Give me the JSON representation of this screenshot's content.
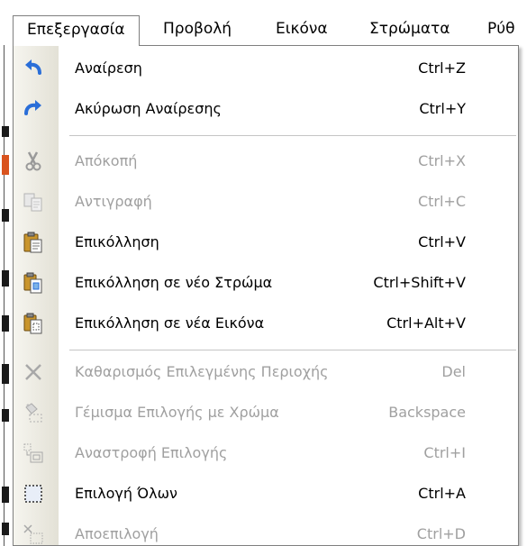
{
  "menubar": {
    "items": [
      {
        "label": "Επεξεργασία",
        "active": true
      },
      {
        "label": "Προβολή"
      },
      {
        "label": "Εικόνα"
      },
      {
        "label": "Στρώματα"
      },
      {
        "label": "Ρύθ"
      }
    ]
  },
  "menu": {
    "items": [
      {
        "label": "Αναίρεση",
        "shortcut": "Ctrl+Z",
        "icon": "undo-icon",
        "enabled": true
      },
      {
        "label": "Ακύρωση Αναίρεσης",
        "shortcut": "Ctrl+Y",
        "icon": "redo-icon",
        "enabled": true
      },
      {
        "label": "Απόκοπή",
        "shortcut": "Ctrl+X",
        "icon": "scissors-icon",
        "enabled": false
      },
      {
        "label": "Αντιγραφή",
        "shortcut": "Ctrl+C",
        "icon": "copy-icon",
        "enabled": false
      },
      {
        "label": "Επικόλληση",
        "shortcut": "Ctrl+V",
        "icon": "paste-icon",
        "enabled": true
      },
      {
        "label": "Επικόλληση σε νέο Στρώμα",
        "shortcut": "Ctrl+Shift+V",
        "icon": "paste-new-layer-icon",
        "enabled": true
      },
      {
        "label": "Επικόλληση σε νέα Εικόνα",
        "shortcut": "Ctrl+Alt+V",
        "icon": "paste-new-image-icon",
        "enabled": true
      },
      {
        "label": "Καθαρισμός Επιλεγμένης Περιοχής",
        "shortcut": "Del",
        "icon": "clear-x-icon",
        "enabled": false
      },
      {
        "label": "Γέμισμα Επιλογής με Χρώμα",
        "shortcut": "Backspace",
        "icon": "fill-bucket-icon",
        "enabled": false
      },
      {
        "label": "Αναστροφή Επιλογής",
        "shortcut": "Ctrl+I",
        "icon": "invert-selection-icon",
        "enabled": false
      },
      {
        "label": "Επιλογή Όλων",
        "shortcut": "Ctrl+A",
        "icon": "select-all-icon",
        "enabled": true
      },
      {
        "label": "Αποεπιλογή",
        "shortcut": "Ctrl+D",
        "icon": "deselect-icon",
        "enabled": false
      }
    ]
  },
  "colors": {
    "accent_blue": "#2a6ed8",
    "disabled_text": "#a0a0a0"
  }
}
